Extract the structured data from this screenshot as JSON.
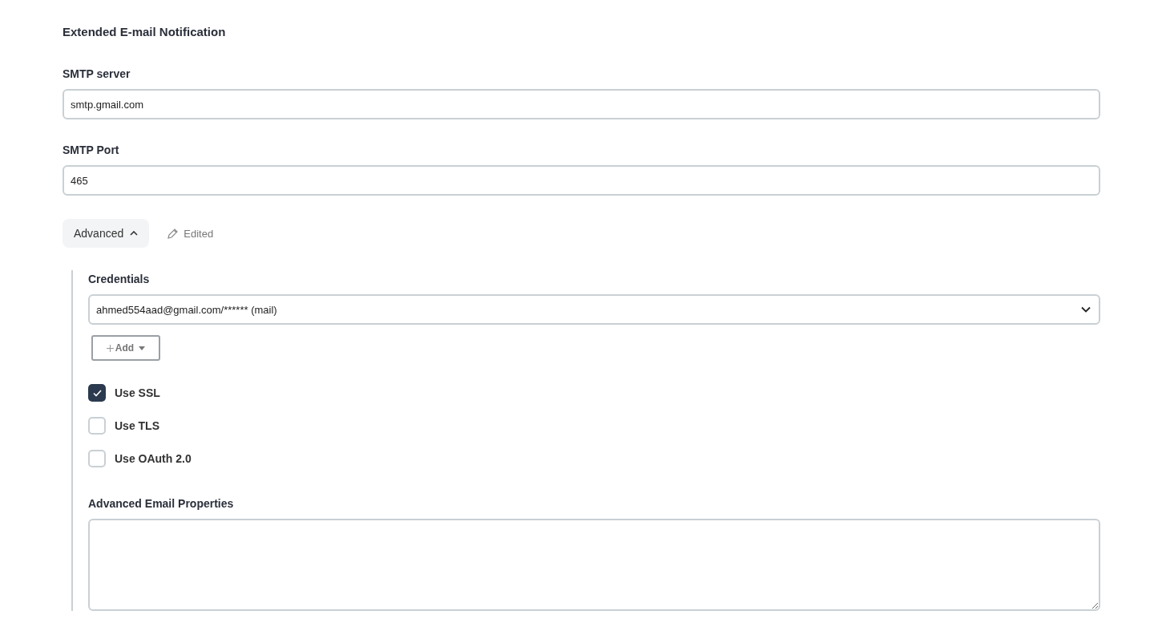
{
  "section": {
    "title": "Extended E-mail Notification"
  },
  "fields": [
    {
      "label": "SMTP server",
      "value": "smtp.gmail.com"
    },
    {
      "label": "SMTP Port",
      "value": "465"
    }
  ],
  "advanced": {
    "label": "Advanced",
    "expanded": true,
    "status": "Edited"
  },
  "credentials": {
    "label": "Credentials",
    "value": "ahmed554aad@gmail.com/****** (mail)",
    "add_button": "Add"
  },
  "options": [
    {
      "label": "Use SSL",
      "checked": true
    },
    {
      "label": "Use TLS",
      "checked": false
    },
    {
      "label": "Use OAuth 2.0",
      "checked": false
    }
  ],
  "properties": {
    "label": "Advanced Email Properties"
  }
}
